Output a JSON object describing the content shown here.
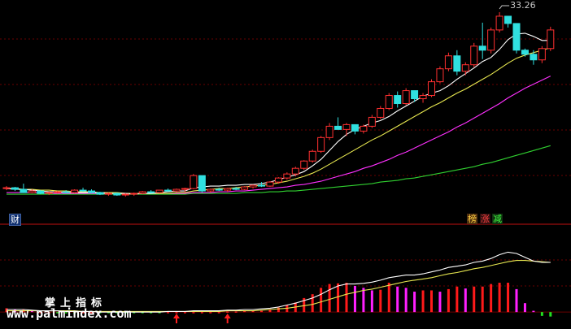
{
  "peak_label": "33.26",
  "tags": {
    "left": "财",
    "right1": "榜",
    "right2": "涨",
    "right3": "减"
  },
  "watermark": {
    "chinese": "掌上指标",
    "url": "www.palmindex.com"
  },
  "colors": {
    "up": "#ff3030",
    "down": "#30e0e0",
    "ma5": "#ffffff",
    "ma10": "#e8e850",
    "ma20": "#ff30ff",
    "ma60": "#30d030",
    "macd_pos": "#ff1a1a",
    "macd_mag": "#ff20ff",
    "macd_neg": "#20e020",
    "divider": "#c01010",
    "grid": "#6a0000"
  },
  "chart_data": [
    {
      "type": "candlestick",
      "title": "",
      "peak_annotation": 33.26,
      "ylim": [
        9.5,
        34.0
      ],
      "candles": [
        [
          11.5,
          11.8,
          11.3,
          11.6
        ],
        [
          11.6,
          11.7,
          11.2,
          11.4
        ],
        [
          11.4,
          12.1,
          11.3,
          11.0
        ],
        [
          11.0,
          11.4,
          10.9,
          11.2
        ],
        [
          11.2,
          11.3,
          10.8,
          10.9
        ],
        [
          10.9,
          11.1,
          10.7,
          11.0
        ],
        [
          11.0,
          11.2,
          10.9,
          11.1
        ],
        [
          11.1,
          11.3,
          10.9,
          11.0
        ],
        [
          11.0,
          11.4,
          10.9,
          11.3
        ],
        [
          11.3,
          11.6,
          11.1,
          11.2
        ],
        [
          11.2,
          11.4,
          10.9,
          11.0
        ],
        [
          11.0,
          11.1,
          10.7,
          10.8
        ],
        [
          10.8,
          11.0,
          10.6,
          10.9
        ],
        [
          10.9,
          11.0,
          10.6,
          10.7
        ],
        [
          10.7,
          10.9,
          10.5,
          10.8
        ],
        [
          10.8,
          11.0,
          10.6,
          10.9
        ],
        [
          10.9,
          11.2,
          10.8,
          11.1
        ],
        [
          11.1,
          11.3,
          10.9,
          11.0
        ],
        [
          11.0,
          11.3,
          10.9,
          11.3
        ],
        [
          11.3,
          11.5,
          11.1,
          11.2
        ],
        [
          11.2,
          11.5,
          11.0,
          11.4
        ],
        [
          11.4,
          11.6,
          11.0,
          11.5
        ],
        [
          11.5,
          13.3,
          11.4,
          13.1
        ],
        [
          13.1,
          11.9,
          11.0,
          11.2
        ],
        [
          11.2,
          11.5,
          11.0,
          11.4
        ],
        [
          11.4,
          11.6,
          11.2,
          11.3
        ],
        [
          11.3,
          11.6,
          11.1,
          11.5
        ],
        [
          11.5,
          11.7,
          11.3,
          11.4
        ],
        [
          11.4,
          11.8,
          11.3,
          11.7
        ],
        [
          11.7,
          12.0,
          11.5,
          11.9
        ],
        [
          11.9,
          12.3,
          11.7,
          11.8
        ],
        [
          11.8,
          12.4,
          11.7,
          12.3
        ],
        [
          12.3,
          12.9,
          12.1,
          12.8
        ],
        [
          12.8,
          13.5,
          12.6,
          13.3
        ],
        [
          13.3,
          14.2,
          13.0,
          14.0
        ],
        [
          14.0,
          15.0,
          13.8,
          14.9
        ],
        [
          14.9,
          16.3,
          14.7,
          16.1
        ],
        [
          16.1,
          18.0,
          15.9,
          17.8
        ],
        [
          17.8,
          19.6,
          17.5,
          19.2
        ],
        [
          19.2,
          20.3,
          18.9,
          18.8
        ],
        [
          18.8,
          19.6,
          18.0,
          19.4
        ],
        [
          19.4,
          18.7,
          18.2,
          18.6
        ],
        [
          18.6,
          19.4,
          18.3,
          19.2
        ],
        [
          19.2,
          20.6,
          19.0,
          20.3
        ],
        [
          20.3,
          21.7,
          20.1,
          21.4
        ],
        [
          21.4,
          23.3,
          21.2,
          23.0
        ],
        [
          23.0,
          23.5,
          21.5,
          22.0
        ],
        [
          22.0,
          23.9,
          21.8,
          23.6
        ],
        [
          23.6,
          23.2,
          22.2,
          22.6
        ],
        [
          22.6,
          23.3,
          22.1,
          23.0
        ],
        [
          23.0,
          25.0,
          22.8,
          24.7
        ],
        [
          24.7,
          26.6,
          24.5,
          26.3
        ],
        [
          26.3,
          28.3,
          26.0,
          27.9
        ],
        [
          27.9,
          28.6,
          25.5,
          26.0
        ],
        [
          26.0,
          27.1,
          25.5,
          26.8
        ],
        [
          26.8,
          29.5,
          26.5,
          29.1
        ],
        [
          29.1,
          32.0,
          27.5,
          28.6
        ],
        [
          28.6,
          31.4,
          28.2,
          31.1
        ],
        [
          31.1,
          33.3,
          30.8,
          32.8
        ],
        [
          32.8,
          32.8,
          31.4,
          31.9
        ],
        [
          31.9,
          31.3,
          28.2,
          28.6
        ],
        [
          28.6,
          28.8,
          27.8,
          28.1
        ],
        [
          28.1,
          28.6,
          26.8,
          27.4
        ],
        [
          27.4,
          29.1,
          27.0,
          28.8
        ],
        [
          28.8,
          31.5,
          28.5,
          31.1
        ]
      ],
      "ma5": [
        11.5,
        11.4,
        11.4,
        11.3,
        11.2,
        11.1,
        11.1,
        11.0,
        11.0,
        11.0,
        11.0,
        11.0,
        10.9,
        10.9,
        10.9,
        10.8,
        10.9,
        10.9,
        11.0,
        11.1,
        11.2,
        11.2,
        11.6,
        11.7,
        11.8,
        11.8,
        11.9,
        11.9,
        12.0,
        12.0,
        12.1,
        12.3,
        12.6,
        12.9,
        13.2,
        13.6,
        14.3,
        15.1,
        16.2,
        17.3,
        18.2,
        18.8,
        19.2,
        19.6,
        19.9,
        20.4,
        21.1,
        21.7,
        22.3,
        22.9,
        23.3,
        23.6,
        24.2,
        25.0,
        25.7,
        26.4,
        27.2,
        27.7,
        28.7,
        29.9,
        30.6,
        30.7,
        30.3,
        29.8,
        29.8
      ],
      "ma10": [
        11.5,
        11.5,
        11.4,
        11.4,
        11.3,
        11.3,
        11.2,
        11.2,
        11.1,
        11.1,
        11.1,
        11.0,
        11.0,
        11.0,
        10.9,
        10.9,
        10.9,
        10.9,
        10.9,
        10.9,
        11.0,
        11.0,
        11.2,
        11.3,
        11.4,
        11.5,
        11.5,
        11.6,
        11.7,
        11.8,
        11.9,
        12.0,
        12.2,
        12.4,
        12.7,
        13.0,
        13.4,
        13.9,
        14.5,
        15.1,
        15.7,
        16.3,
        16.9,
        17.5,
        18.0,
        18.6,
        19.2,
        19.8,
        20.4,
        21.0,
        21.6,
        22.1,
        22.7,
        23.3,
        23.8,
        24.4,
        25.0,
        25.6,
        26.3,
        27.0,
        27.6,
        28.0,
        28.3,
        28.6,
        28.9
      ],
      "ma20": [
        11.0,
        11.0,
        11.0,
        11.0,
        11.0,
        10.9,
        10.9,
        10.9,
        10.9,
        10.9,
        10.9,
        10.9,
        10.9,
        10.9,
        10.9,
        10.9,
        10.9,
        10.9,
        10.9,
        10.9,
        10.9,
        10.9,
        11.0,
        11.0,
        11.0,
        11.1,
        11.1,
        11.2,
        11.2,
        11.3,
        11.4,
        11.5,
        11.6,
        11.7,
        11.9,
        12.0,
        12.2,
        12.4,
        12.7,
        13.0,
        13.3,
        13.6,
        14.0,
        14.3,
        14.7,
        15.1,
        15.6,
        16.0,
        16.5,
        17.0,
        17.5,
        18.0,
        18.5,
        19.1,
        19.6,
        20.2,
        20.8,
        21.4,
        22.0,
        22.7,
        23.3,
        23.9,
        24.4,
        24.9,
        25.4
      ],
      "ma60": [
        10.8,
        10.8,
        10.8,
        10.8,
        10.8,
        10.8,
        10.8,
        10.8,
        10.8,
        10.8,
        10.8,
        10.8,
        10.8,
        10.8,
        10.8,
        10.8,
        10.8,
        10.8,
        10.8,
        10.8,
        10.8,
        10.8,
        10.9,
        10.9,
        10.9,
        10.9,
        10.9,
        10.9,
        11.0,
        11.0,
        11.0,
        11.1,
        11.1,
        11.2,
        11.2,
        11.3,
        11.4,
        11.5,
        11.6,
        11.7,
        11.8,
        11.9,
        12.0,
        12.1,
        12.3,
        12.4,
        12.5,
        12.7,
        12.8,
        13.0,
        13.2,
        13.4,
        13.6,
        13.8,
        14.0,
        14.2,
        14.5,
        14.7,
        15.0,
        15.3,
        15.6,
        15.9,
        16.2,
        16.5,
        16.8
      ]
    },
    {
      "type": "bar",
      "title": "",
      "ylim": [
        -0.5,
        6.0
      ],
      "dif": [
        0.2,
        0.2,
        0.2,
        0.15,
        0.1,
        0.1,
        0.1,
        0.05,
        0.05,
        0.05,
        0.05,
        0.0,
        0.0,
        0.0,
        0.0,
        0.0,
        0.0,
        0.0,
        0.0,
        0.05,
        0.05,
        0.05,
        0.1,
        0.1,
        0.1,
        0.1,
        0.15,
        0.15,
        0.2,
        0.2,
        0.25,
        0.3,
        0.4,
        0.55,
        0.7,
        0.9,
        1.1,
        1.4,
        1.75,
        2.05,
        2.2,
        2.2,
        2.25,
        2.35,
        2.5,
        2.7,
        2.8,
        2.9,
        2.9,
        3.0,
        3.15,
        3.3,
        3.5,
        3.6,
        3.7,
        3.9,
        4.0,
        4.2,
        4.5,
        4.7,
        4.6,
        4.3,
        4.0,
        3.9,
        3.9
      ],
      "dea": [
        0.1,
        0.1,
        0.1,
        0.1,
        0.1,
        0.1,
        0.1,
        0.1,
        0.1,
        0.05,
        0.05,
        0.05,
        0.05,
        0.05,
        0.05,
        0.05,
        0.05,
        0.05,
        0.05,
        0.05,
        0.05,
        0.05,
        0.05,
        0.05,
        0.05,
        0.05,
        0.1,
        0.1,
        0.1,
        0.1,
        0.15,
        0.2,
        0.25,
        0.3,
        0.4,
        0.5,
        0.6,
        0.8,
        1.0,
        1.2,
        1.4,
        1.55,
        1.7,
        1.8,
        1.95,
        2.1,
        2.25,
        2.4,
        2.5,
        2.6,
        2.7,
        2.85,
        3.0,
        3.1,
        3.25,
        3.4,
        3.5,
        3.65,
        3.8,
        3.95,
        4.05,
        4.05,
        4.0,
        3.95,
        3.9
      ],
      "macd": [
        0.3,
        0.2,
        0.2,
        0.1,
        0.0,
        0.0,
        -0.05,
        -0.05,
        -0.05,
        0.0,
        0.0,
        -0.05,
        -0.05,
        -0.05,
        -0.05,
        -0.05,
        -0.05,
        -0.05,
        -0.05,
        0.0,
        0.0,
        0.0,
        0.0,
        0.0,
        0.0,
        0.0,
        0.05,
        0.05,
        0.1,
        0.1,
        0.1,
        0.2,
        0.35,
        0.55,
        0.75,
        1.1,
        1.4,
        1.9,
        2.2,
        2.25,
        2.3,
        2.05,
        1.9,
        1.7,
        1.75,
        2.3,
        2.0,
        1.9,
        1.6,
        1.7,
        1.7,
        1.6,
        1.8,
        2.0,
        1.85,
        2.0,
        2.0,
        2.2,
        2.3,
        2.3,
        1.8,
        0.7,
        0.1,
        -0.3,
        -0.35
      ],
      "arrows_at": [
        20,
        26
      ]
    }
  ]
}
